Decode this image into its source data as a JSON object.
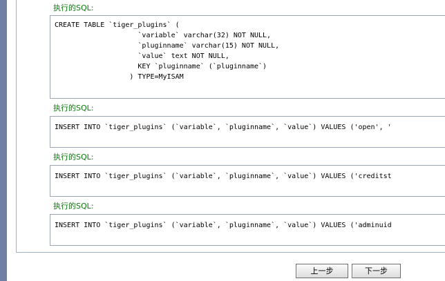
{
  "sections": [
    {
      "label": "执行的SQL:",
      "sql": "CREATE TABLE `tiger_plugins` (\n                    `variable` varchar(32) NOT NULL,\n                    `pluginname` varchar(15) NOT NULL,\n                    `value` text NOT NULL,\n                    KEY `pluginname` (`pluginname`)\n                  ) TYPE=MyISAM"
    },
    {
      "label": "执行的SQL:",
      "sql": "INSERT INTO `tiger_plugins` (`variable`, `pluginname`, `value`) VALUES ('open', '"
    },
    {
      "label": "执行的SQL:",
      "sql": "INSERT INTO `tiger_plugins` (`variable`, `pluginname`, `value`) VALUES ('creditst"
    },
    {
      "label": "执行的SQL:",
      "sql": "INSERT INTO `tiger_plugins` (`variable`, `pluginname`, `value`) VALUES ('adminuid"
    }
  ],
  "navigation": {
    "prev_label": "上一步",
    "next_label": "下一步"
  }
}
